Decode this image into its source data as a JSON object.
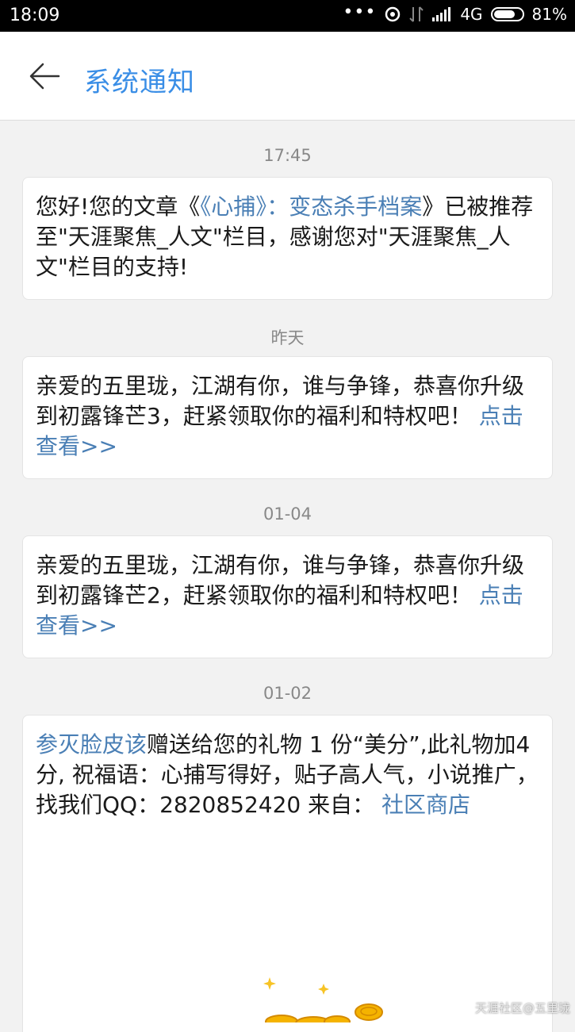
{
  "status_bar": {
    "time": "18:09",
    "network": "4G",
    "battery": "81%",
    "battery_level": 0.81
  },
  "header": {
    "title": "系统通知"
  },
  "messages": [
    {
      "time": "17:45",
      "pre": "您好!您的文章《",
      "link": "《心捕》：变态杀手档案",
      "post": "》已被推荐至\"天涯聚焦_人文\"栏目，感谢您对\"天涯聚焦_人文\"栏目的支持!"
    },
    {
      "time": "昨天",
      "text": "亲爱的五里珑，江湖有你，谁与争锋，恭喜你升级到初露锋芒3，赶紧领取你的福利和特权吧！",
      "link": "点击查看>>"
    },
    {
      "time": "01-04",
      "text": "亲爱的五里珑，江湖有你，谁与争锋，恭喜你升级到初露锋芒2，赶紧领取你的福利和特权吧！",
      "link": "点击查看>>"
    },
    {
      "time": "01-02",
      "sender": "参灭脸皮该",
      "text": "赠送给您的礼物 1 份“美分”,此礼物加4分, 祝福语：心捕写得好，贴子高人气，小说推广，找我们QQ：2820852420 来自：",
      "link": "社区商店"
    }
  ],
  "watermark": "天涯社区@五里珑",
  "colors": {
    "accent": "#3a8ee6",
    "link": "#4a7fb5",
    "background": "#f2f2f2"
  }
}
